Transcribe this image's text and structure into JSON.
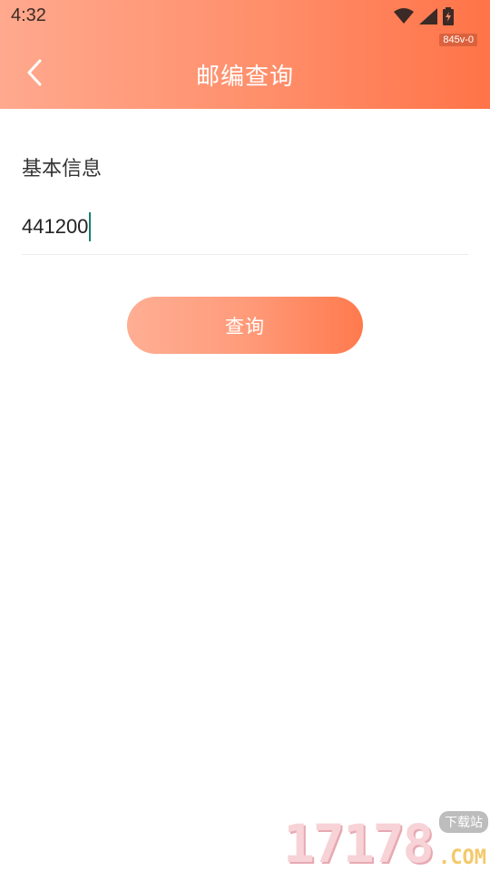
{
  "status_bar": {
    "time": "4:32",
    "build_tag": "845v-0"
  },
  "header": {
    "title": "邮编查询"
  },
  "form": {
    "section_label": "基本信息",
    "postcode_value": "441200"
  },
  "actions": {
    "query_label": "查询"
  },
  "watermark": {
    "number": "17178",
    "domain": ".COM",
    "tag": "下载站"
  },
  "colors": {
    "header_gradient_start": "#FFA98E",
    "header_gradient_end": "#FF7448",
    "caret": "#14806f"
  }
}
